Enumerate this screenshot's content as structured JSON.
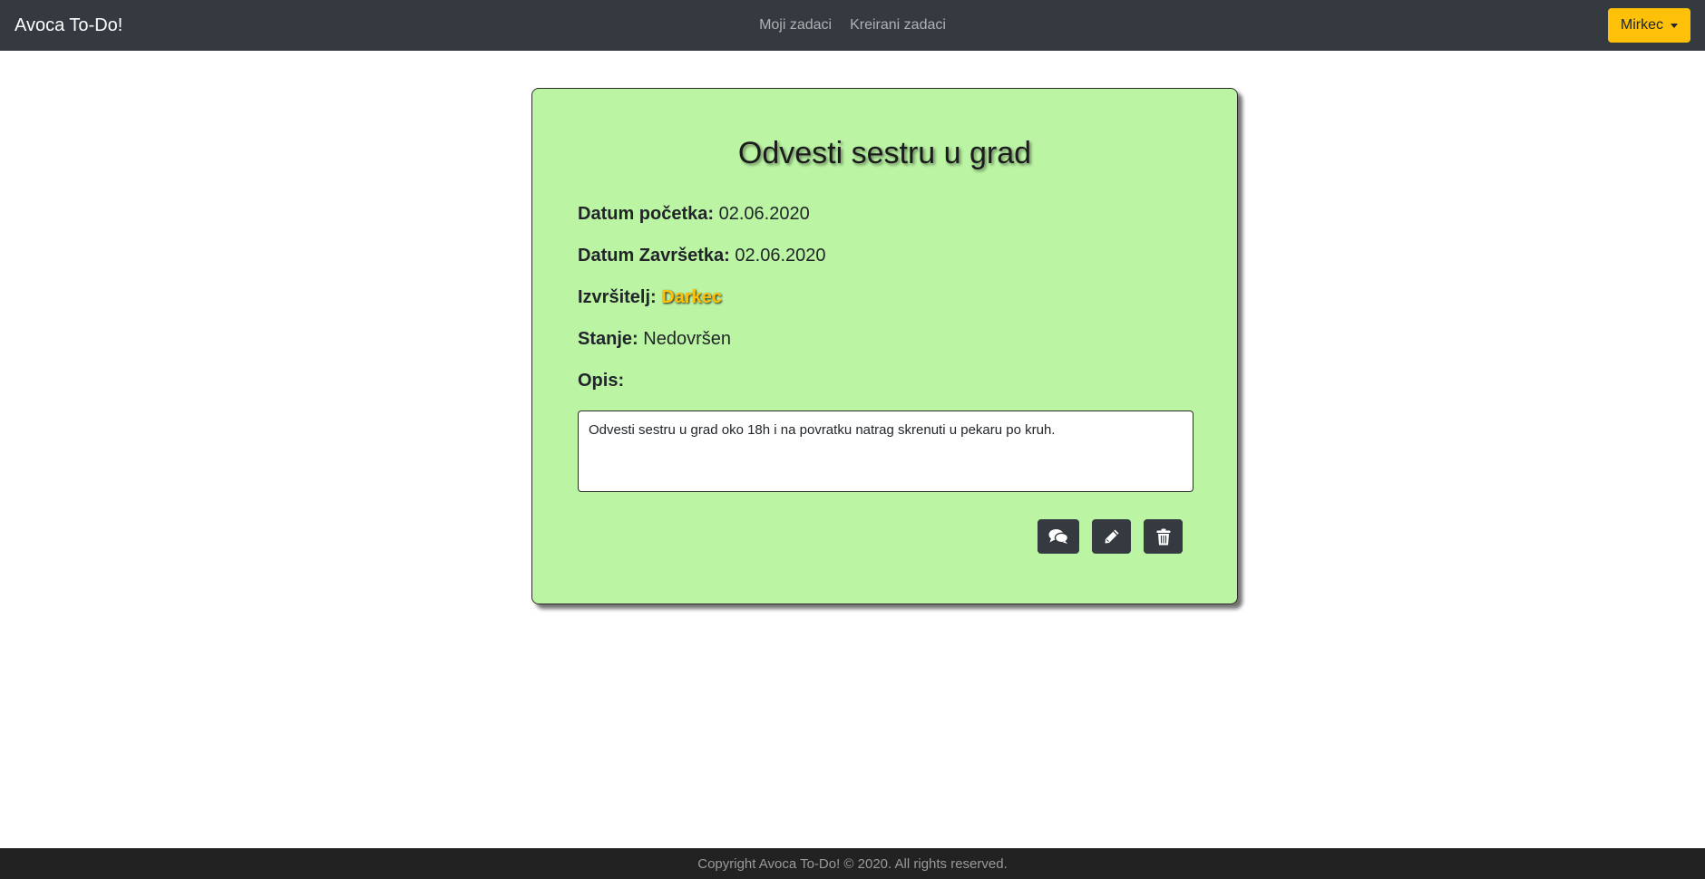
{
  "navbar": {
    "brand": "Avoca To-Do!",
    "links": [
      "Moji zadaci",
      "Kreirani zadaci"
    ],
    "user_button": "Mirkec",
    "bg_color": "#343a40",
    "user_button_color": "#ffc107"
  },
  "task": {
    "title": "Odvesti sestru u grad",
    "start_label": "Datum početka:",
    "start_value": "02.06.2020",
    "end_label": "Datum Završetka:",
    "end_value": "02.06.2020",
    "assignee_label": "Izvršitelj:",
    "assignee_value": "Darkec",
    "status_label": "Stanje:",
    "status_value": "Nedovršen",
    "description_label": "Opis:",
    "description_value": "Odvesti sestru u grad oko 18h i na povratku natrag skrenuti u pekaru po kruh.",
    "card_color": "#bbf5a4"
  },
  "actions": [
    {
      "icon": "comments-icon",
      "name": "comments-button"
    },
    {
      "icon": "pencil-icon",
      "name": "edit-button"
    },
    {
      "icon": "trash-icon",
      "name": "delete-button"
    }
  ],
  "footer": {
    "text": "Copyright Avoca To-Do! © 2020. All rights reserved."
  }
}
